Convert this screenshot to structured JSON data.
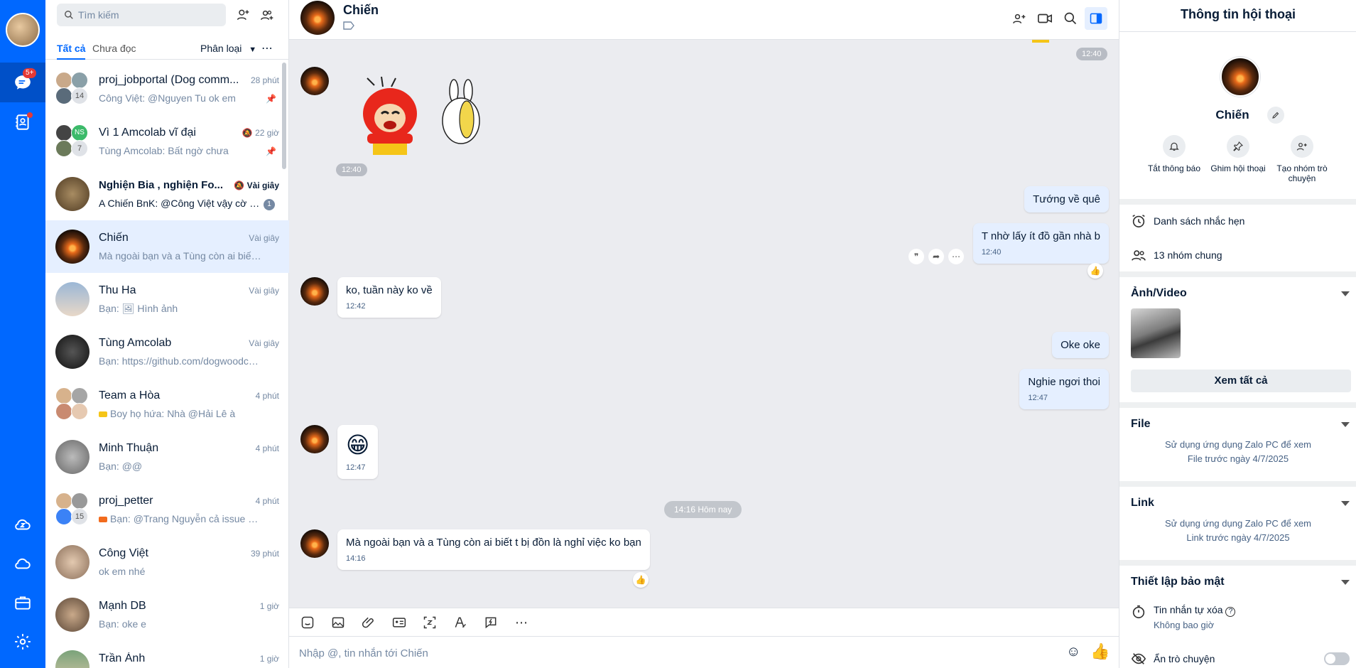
{
  "nav": {
    "badge": "5+"
  },
  "search": {
    "placeholder": "Tìm kiếm"
  },
  "filters": {
    "all": "Tất cả",
    "unread": "Chưa đọc",
    "classify": "Phân loại"
  },
  "conversations": [
    {
      "title": "proj_jobportal (Dog comm...",
      "time": "28 phút",
      "preview": "Công Việt: @Nguyen Tu ok em",
      "count": "14",
      "pinned": true
    },
    {
      "title": "Vì 1 Amcolab vĩ đại",
      "time": "22 giờ",
      "preview": "Tùng Amcolab: Bất ngờ chưa",
      "count": "7",
      "initials": "NS",
      "pinned": true
    },
    {
      "title": "Nghiện Bia , nghiện Fo...",
      "time": "Vài giây",
      "preview": "A Chiến BnK: @Công Việt vậy cờ c...",
      "unread": "1"
    },
    {
      "title": "Chiến",
      "time": "Vài giây",
      "preview": "Mà ngoài bạn và a Tùng còn ai biết t b..."
    },
    {
      "title": "Thu Ha",
      "time": "Vài giây",
      "preview": "Hình ảnh",
      "preview_prefix": "Bạn:"
    },
    {
      "title": "Tùng Amcolab",
      "time": "Vài giây",
      "preview": "Bạn: https://github.com/dogwoodco..."
    },
    {
      "title": "Team a Hòa",
      "time": "4 phút",
      "preview": "Boy họ hứa: Nhà @Hải Lê à"
    },
    {
      "title": "Minh Thuận",
      "time": "4 phút",
      "preview": "Bạn: @@"
    },
    {
      "title": "proj_petter",
      "time": "4 phút",
      "preview": "Bạn: @Trang Nguyễn cả issue 519 ...",
      "count": "15"
    },
    {
      "title": "Công Việt",
      "time": "39 phút",
      "preview": "ok em nhé"
    },
    {
      "title": "Mạnh DB",
      "time": "1 giờ",
      "preview": "Bạn: oke e"
    },
    {
      "title": "Trần Ánh",
      "time": "1 giờ",
      "preview": ""
    }
  ],
  "chat": {
    "name": "Chiến",
    "top_time": "12:40",
    "sticker_time": "12:40",
    "messages": [
      {
        "text": "Tướng về quê",
        "from": "me"
      },
      {
        "text": "T nhờ lấy ít đồ gần nhà b",
        "time": "12:40",
        "from": "me"
      },
      {
        "text": "ko, tuần này ko về",
        "time": "12:42",
        "from": "them"
      },
      {
        "text": "Oke oke",
        "from": "me"
      },
      {
        "text": "Nghie ngơi thoi",
        "time": "12:47",
        "from": "me"
      },
      {
        "text": "😁",
        "time": "12:47",
        "from": "them"
      },
      {
        "text": "Mà ngoài bạn và a Tùng còn ai biết t bị đồn là nghỉ việc ko bạn",
        "time": "14:16",
        "from": "them"
      }
    ],
    "divider": "14:16 Hôm nay",
    "composer_placeholder": "Nhập @, tin nhắn tới Chiến"
  },
  "info": {
    "title": "Thông tin hội thoại",
    "name": "Chiến",
    "actions": [
      {
        "label": "Tắt thông báo",
        "icon": "bell-icon"
      },
      {
        "label": "Ghim hội thoại",
        "icon": "pin-icon"
      },
      {
        "label": "Tạo nhóm trò chuyện",
        "icon": "add-group-icon"
      }
    ],
    "reminders": "Danh sách nhắc hẹn",
    "common_groups": "13 nhóm chung",
    "media_title": "Ảnh/Video",
    "see_all": "Xem tất cả",
    "file_title": "File",
    "file_note_1": "Sử dụng ứng dụng Zalo PC để xem",
    "file_note_2": "File trước ngày 4/7/2025",
    "link_title": "Link",
    "link_note_1": "Sử dụng ứng dụng Zalo PC để xem",
    "link_note_2": "Link trước ngày 4/7/2025",
    "security_title": "Thiết lập bảo mật",
    "self_destruct": "Tin nhắn tự xóa",
    "self_destruct_value": "Không bao giờ",
    "hide_chat": "Ẩn trò chuyện"
  },
  "colors": {
    "brand": "#0068ff",
    "my_bubble": "#e5efff",
    "chat_bg": "#ebecf0"
  }
}
